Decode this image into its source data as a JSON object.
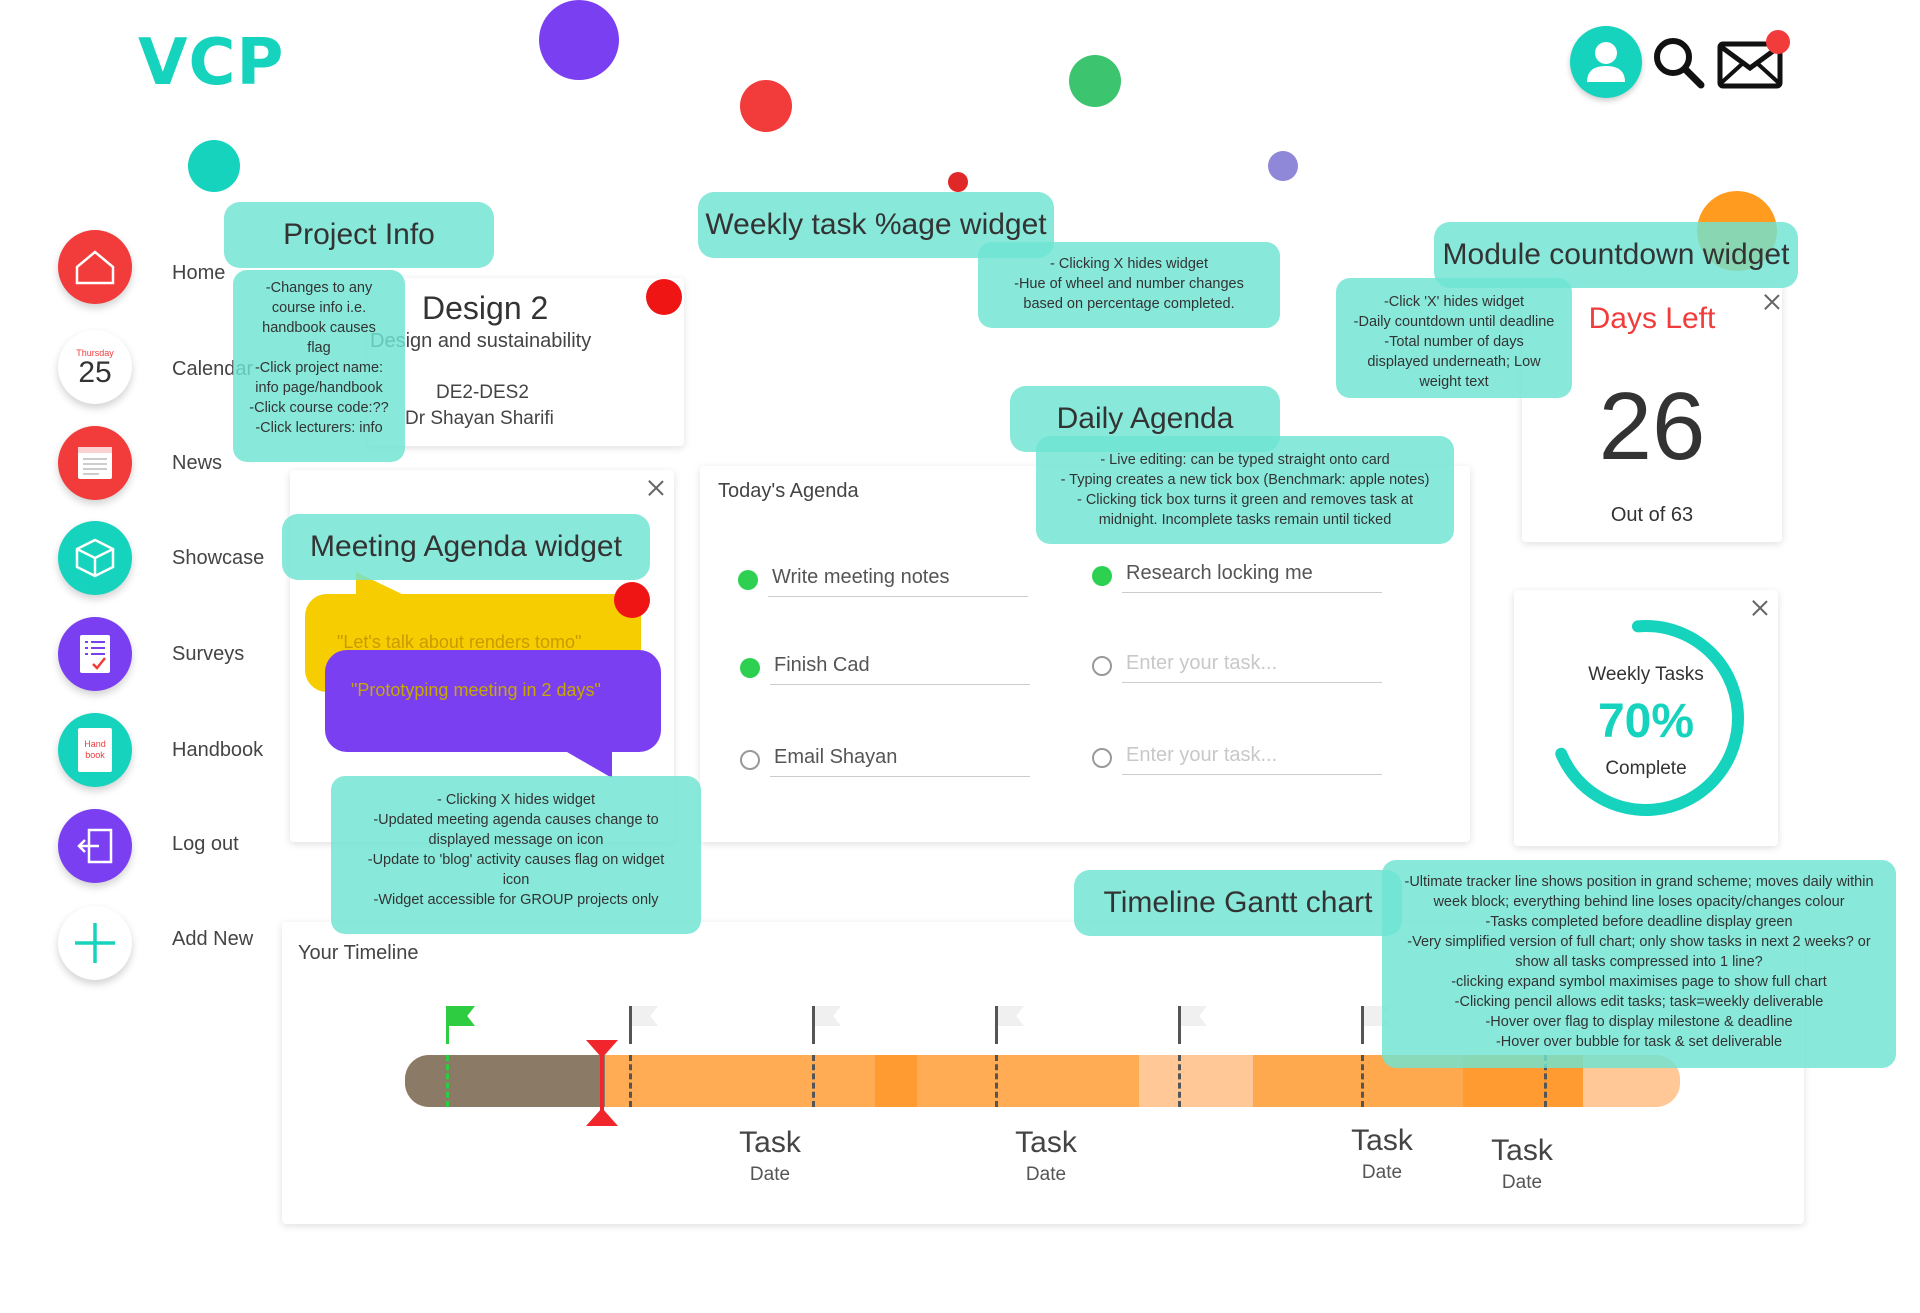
{
  "app": {
    "logo": "VCP"
  },
  "sidebar": {
    "items": [
      {
        "label": "Home",
        "icon": "home-icon"
      },
      {
        "label": "Calendar",
        "icon": "calendar-icon",
        "day_name": "Thursday",
        "day_num": "25"
      },
      {
        "label": "News",
        "icon": "news-icon"
      },
      {
        "label": "Showcase",
        "icon": "cube-icon"
      },
      {
        "label": "Surveys",
        "icon": "survey-icon"
      },
      {
        "label": "Handbook",
        "icon": "handbook-icon",
        "icon_text_1": "Hand",
        "icon_text_2": "book"
      },
      {
        "label": "Log out",
        "icon": "logout-icon"
      },
      {
        "label": "Add New",
        "icon": "plus-icon"
      }
    ]
  },
  "header": {
    "icons": [
      "user-icon",
      "search-icon",
      "mail-icon"
    ]
  },
  "project": {
    "name": "Design 2",
    "subtitle": "Design and sustainability",
    "code": "DE2-DES2",
    "lecturer": "Dr Shayan Sharifi"
  },
  "countdown": {
    "title": "Days Left",
    "value": "26",
    "total_text": "Out of 63"
  },
  "weekly": {
    "label_top": "Weekly Tasks",
    "percent_text": "70%",
    "percent": 0.7,
    "label_bottom": "Complete"
  },
  "agenda": {
    "title": "Today's Agenda",
    "tasks_left": [
      {
        "text": "Write meeting notes",
        "done": true
      },
      {
        "text": "Finish Cad",
        "done": true
      },
      {
        "text": "Email Shayan",
        "done": false
      }
    ],
    "tasks_right": [
      {
        "text": "Research locking me",
        "done": true
      },
      {
        "text": "Enter your task...",
        "done": false,
        "placeholder": true
      },
      {
        "text": "Enter your task...",
        "done": false,
        "placeholder": true
      }
    ]
  },
  "meeting": {
    "bubble_1": "\"Let's talk about renders tomo\"",
    "bubble_2": "\"Prototyping meeting in 2 days\""
  },
  "timeline": {
    "title": "Your Timeline",
    "tasks": [
      {
        "task": "Task",
        "date": "Date"
      },
      {
        "task": "Task",
        "date": "Date"
      },
      {
        "task": "Task",
        "date": "Date"
      },
      {
        "task": "Task",
        "date": "Date"
      }
    ]
  },
  "annotations": {
    "project_info_title": "Project Info",
    "project_info_note_1": "-Changes to any",
    "project_info_note_2": "course info i.e.",
    "project_info_note_3": "handbook causes",
    "project_info_note_4": "flag",
    "project_info_note_5": "-Click project name:",
    "project_info_note_6": "info page/handbook",
    "project_info_note_7": "-Click course code:??",
    "project_info_note_8": "-Click lecturers: info",
    "weekly_title": "Weekly task %age widget",
    "weekly_note_1": "- Clicking X hides widget",
    "weekly_note_2": "-Hue of wheel and number changes",
    "weekly_note_3": "based on percentage completed.",
    "module_title": "Module countdown widget",
    "module_note_1": "-Click 'X' hides widget",
    "module_note_2": "-Daily countdown until deadline",
    "module_note_3": "-Total number of days",
    "module_note_4": "displayed underneath; Low",
    "module_note_5": "weight text",
    "daily_title": "Daily Agenda",
    "daily_note_1": "- Live editing: can be typed straight onto card",
    "daily_note_2": "- Typing creates a new tick box (Benchmark: apple notes)",
    "daily_note_3": "- Clicking tick box turns it green and removes task at",
    "daily_note_4": "midnight. Incomplete tasks remain until ticked",
    "meeting_title": "Meeting Agenda widget",
    "meeting_note_1": "- Clicking X hides widget",
    "meeting_note_2": "-Updated meeting agenda causes change to",
    "meeting_note_3": "displayed message on icon",
    "meeting_note_4": "-Update to 'blog' activity causes flag on widget",
    "meeting_note_5": "icon",
    "meeting_note_6": "-Widget accessible for GROUP projects only",
    "gantt_title": "Timeline Gantt chart",
    "gantt_note_1": "-Ultimate tracker line shows position in grand scheme; moves daily within",
    "gantt_note_2": "week block; everything behind line loses opacity/changes colour",
    "gantt_note_3": "-Tasks completed before deadline display green",
    "gantt_note_4": "-Very simplified version of full chart; only show tasks in next 2 weeks? or",
    "gantt_note_5": "show all tasks compressed into 1 line?",
    "gantt_note_6": "-clicking expand symbol maximises page to show full chart",
    "gantt_note_7": "-Clicking pencil allows edit tasks; task=weekly deliverable",
    "gantt_note_8": "-Hover over flag to display milestone & deadline",
    "gantt_note_9": "-Hover over bubble for task & set deliverable"
  },
  "colors": {
    "teal": "#16d3be",
    "red": "#f23b3b",
    "purple": "#7b3ff2",
    "yellow": "#f6cd00",
    "orange": "#ffb25b",
    "green": "#2ed052"
  }
}
